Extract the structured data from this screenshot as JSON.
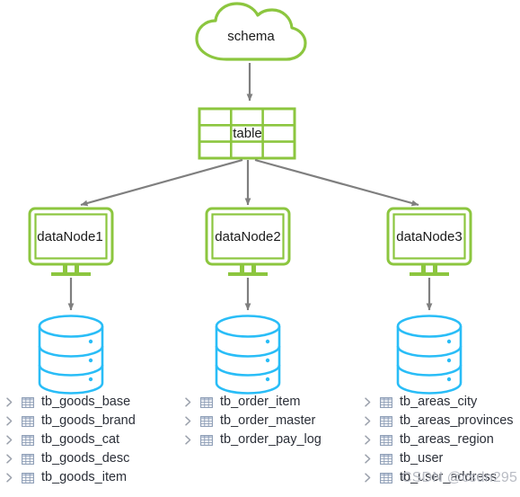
{
  "diagram": {
    "colors": {
      "green": "#8cc63f",
      "cyan": "#29bdf7",
      "arrow": "#7f7f7f",
      "text": "#1a1a1a",
      "icon_grid": "#8a9bb4",
      "chevron": "#9aa0ab",
      "watermark": "#b9bcc4"
    },
    "schema": {
      "label": "schema"
    },
    "table": {
      "label": "table"
    },
    "data_nodes": [
      {
        "label": "dataNode1"
      },
      {
        "label": "dataNode2"
      },
      {
        "label": "dataNode3"
      }
    ],
    "databases": [
      {
        "name": "database-cylinder-1"
      },
      {
        "name": "database-cylinder-2"
      },
      {
        "name": "database-cylinder-3"
      }
    ],
    "table_lists": [
      {
        "items": [
          {
            "label": "tb_goods_base"
          },
          {
            "label": "tb_goods_brand"
          },
          {
            "label": "tb_goods_cat"
          },
          {
            "label": "tb_goods_desc"
          },
          {
            "label": "tb_goods_item"
          }
        ]
      },
      {
        "items": [
          {
            "label": "tb_order_item"
          },
          {
            "label": "tb_order_master"
          },
          {
            "label": "tb_order_pay_log"
          }
        ]
      },
      {
        "items": [
          {
            "label": "tb_areas_city"
          },
          {
            "label": "tb_areas_provinces"
          },
          {
            "label": "tb_areas_region"
          },
          {
            "label": "tb_user"
          },
          {
            "label": "tb_user_address"
          }
        ]
      }
    ],
    "watermark": {
      "text": "CSDN @csdn295"
    }
  }
}
